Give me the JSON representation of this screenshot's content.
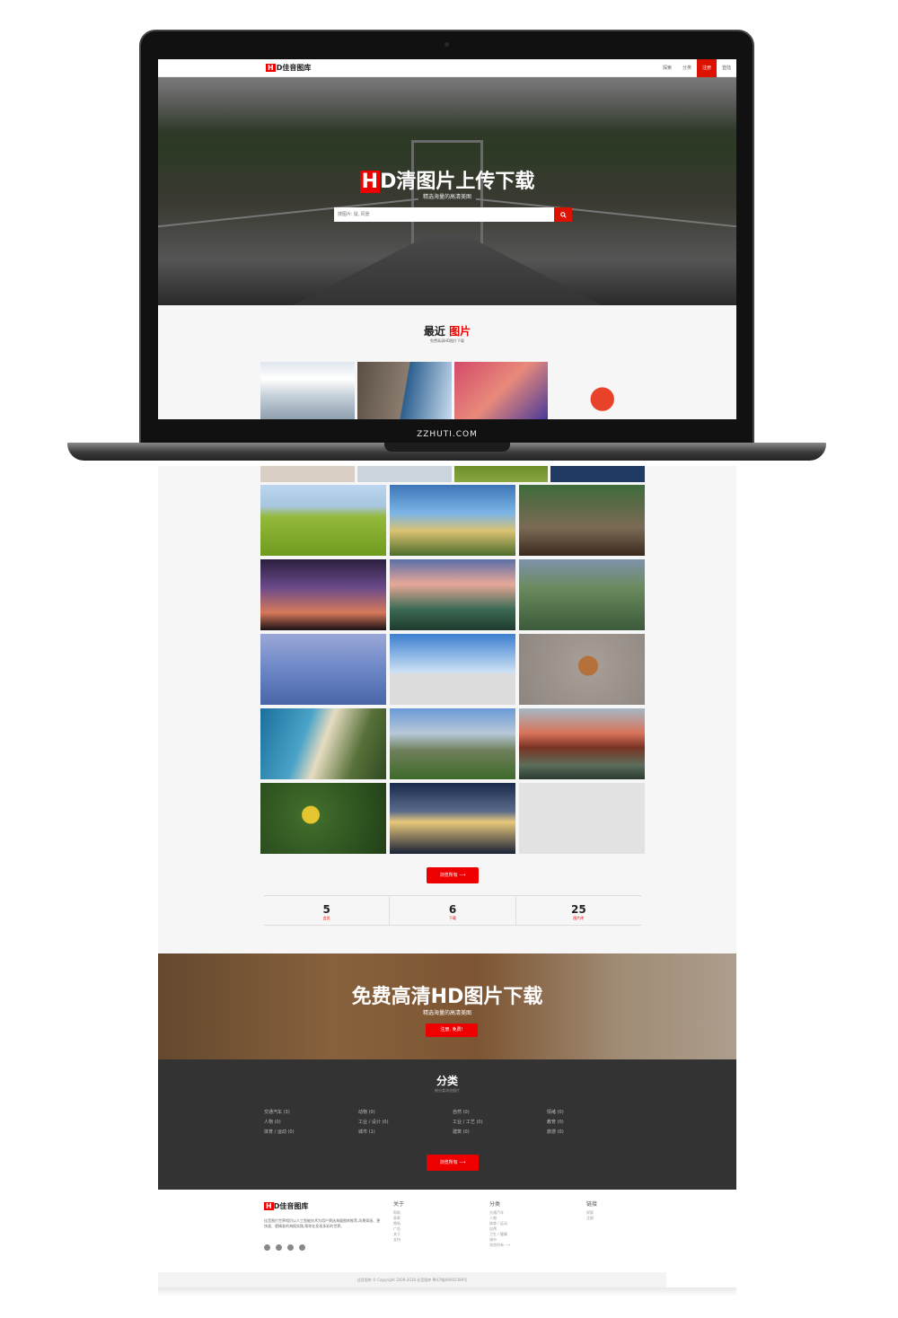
{
  "laptop": {
    "brand": "ZZHUTI.COM"
  },
  "site": {
    "logo_h": "H",
    "logo_text": "D佳音图库",
    "nav": [
      "探索",
      "分类",
      "注册",
      "登陆"
    ]
  },
  "hero": {
    "title_h": "H",
    "title_text": "D清图片上传下载",
    "subtitle": "精选海量的高清美图",
    "search_placeholder": "搜图片: 鼠, 风景"
  },
  "recent": {
    "title_a": "最近",
    "title_b": "图片",
    "subtitle": "免费高清HD图片下载"
  },
  "browse_label": "浏览所有 ⟶",
  "stats": [
    {
      "num": "5",
      "label": "会员"
    },
    {
      "num": "6",
      "label": "下载"
    },
    {
      "num": "25",
      "label": "图片库"
    }
  ],
  "banner": {
    "title": "免费高清HD图片下载",
    "subtitle": "精选海量的高清美图",
    "button": "注册, 免费!"
  },
  "categories": {
    "title": "分类",
    "subtitle": "按分类浏览图片",
    "items": [
      "交通汽车 (3)",
      "动物 (0)",
      "自然 (0)",
      "情绪 (0)",
      "人物 (0)",
      "工业 / 设计 (0)",
      "工业 / 工艺 (0)",
      "教育 (0)",
      "体育 / 运动 (0)",
      "城市 (1)",
      "建筑 (0)",
      "旅游 (0)"
    ],
    "button": "浏览所有 ⟶"
  },
  "footer": {
    "logo_h": "H",
    "logo_text": "D佳音图库",
    "desc": "佳音图片世界相识以人工智能技术为用户筛选海量图库推荐,风景如画、更快速、更精准的海报实践,帮你在发现多彩的世界。",
    "cols": [
      {
        "head": "关于",
        "items": [
          "帮助",
          "条款",
          "隐私",
          "广告",
          "关于",
          "支持"
        ]
      },
      {
        "head": "分类",
        "items": [
          "交通汽车",
          "人物",
          "体育 / 运动",
          "自然",
          "卫生 / 健康",
          "城市",
          "浏览所有 ⟶"
        ]
      },
      {
        "head": "链接",
        "items": [
          "探索",
          "注册"
        ]
      }
    ],
    "copyright": "佳音图库 © Copyright 2009-2018 佳音图库 粤ICP备09002389号"
  },
  "colors": {
    "accent": "#e00000",
    "dark_section": "#333333"
  }
}
